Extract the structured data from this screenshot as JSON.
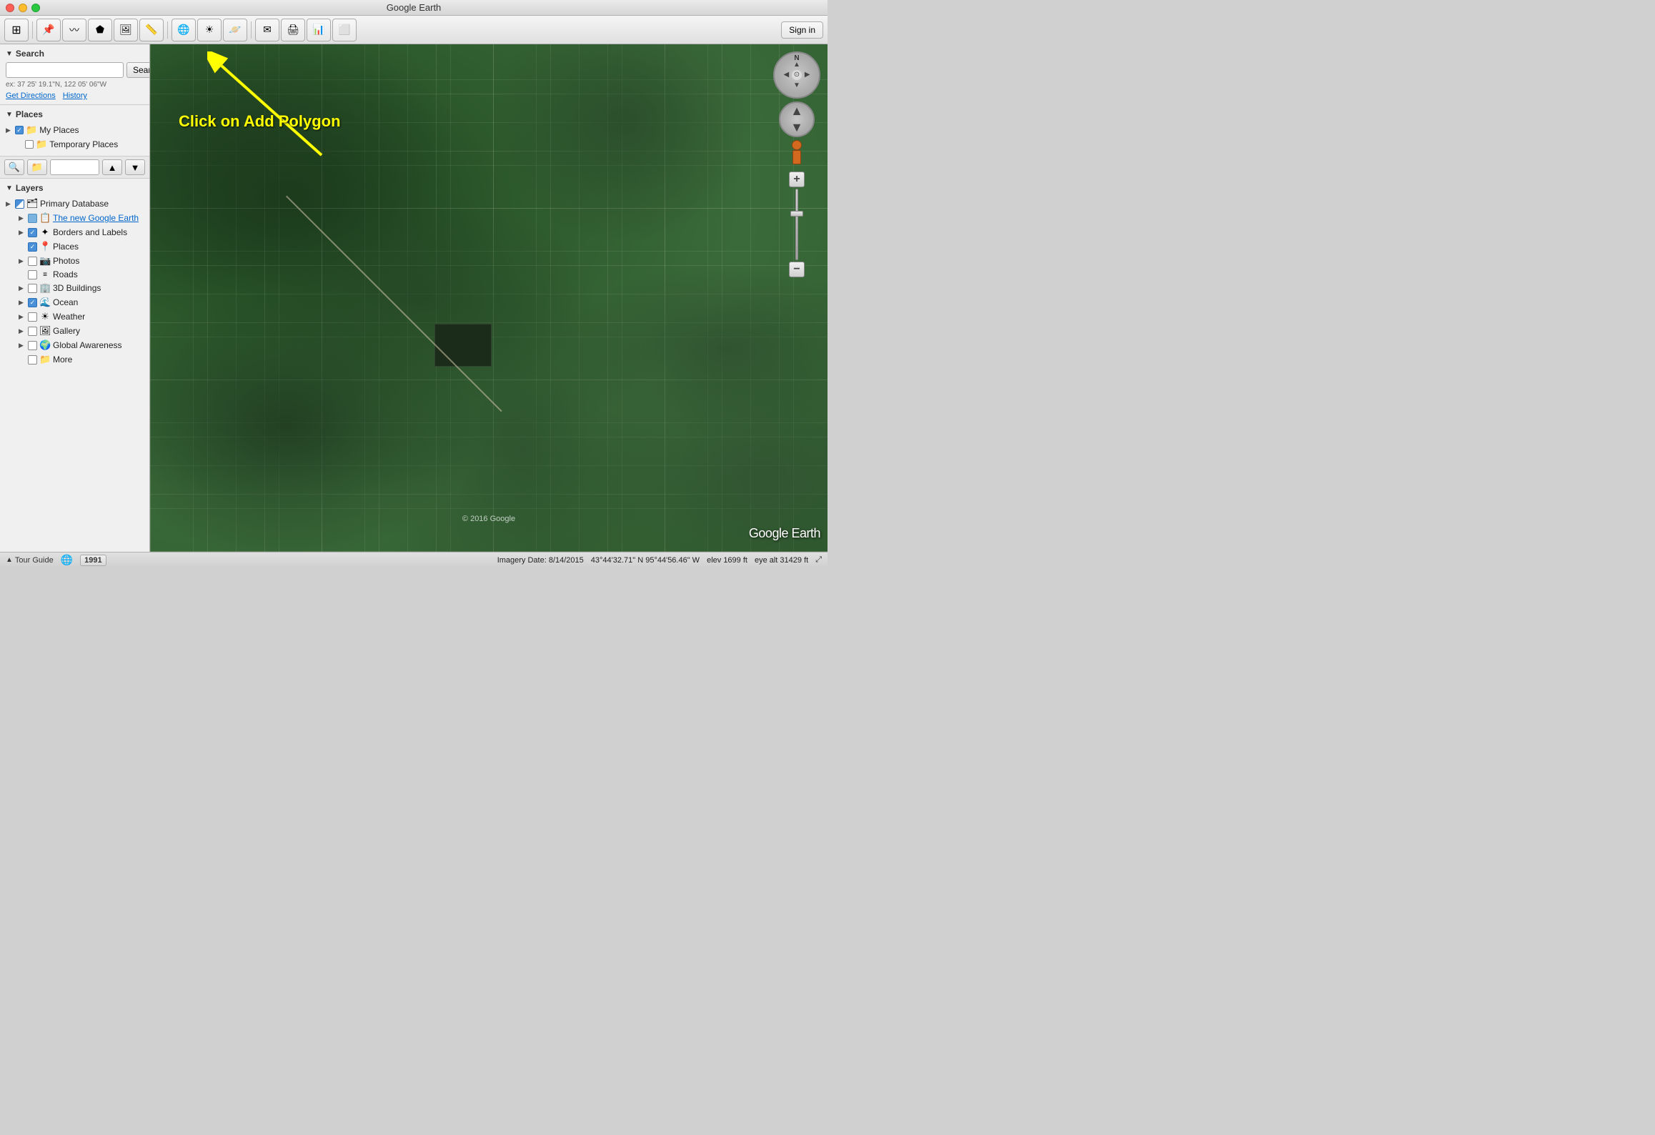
{
  "window": {
    "title": "Google Earth"
  },
  "toolbar": {
    "signin_label": "Sign in"
  },
  "search": {
    "header": "Search",
    "placeholder": "",
    "button_label": "Search",
    "hint": "ex: 37 25' 19.1\"N, 122 05' 06\"W",
    "get_directions_label": "Get Directions",
    "history_label": "History"
  },
  "places": {
    "header": "Places",
    "items": [
      {
        "label": "My Places",
        "checked": true,
        "has_arrow": true
      },
      {
        "label": "Temporary Places",
        "checked": false,
        "has_arrow": false
      }
    ]
  },
  "layers": {
    "header": "Layers",
    "items": [
      {
        "label": "Primary Database",
        "icon": "🗂",
        "has_arrow": true,
        "checked": "half",
        "indent": 0
      },
      {
        "label": "The new Google Earth",
        "icon": "📋",
        "has_arrow": true,
        "checked": false,
        "indent": 1,
        "is_link": true
      },
      {
        "label": "Borders and Labels",
        "icon": "✦",
        "has_arrow": true,
        "checked": true,
        "indent": 1
      },
      {
        "label": "Places",
        "icon": "📍",
        "has_arrow": false,
        "checked": true,
        "indent": 1
      },
      {
        "label": "Photos",
        "icon": "📷",
        "has_arrow": true,
        "checked": false,
        "indent": 1
      },
      {
        "label": "Roads",
        "icon": "≡",
        "has_arrow": false,
        "checked": false,
        "indent": 1
      },
      {
        "label": "3D Buildings",
        "icon": "🏢",
        "has_arrow": true,
        "checked": false,
        "indent": 1
      },
      {
        "label": "Ocean",
        "icon": "🌊",
        "has_arrow": true,
        "checked": true,
        "indent": 1
      },
      {
        "label": "Weather",
        "icon": "☀",
        "has_arrow": true,
        "checked": false,
        "indent": 1
      },
      {
        "label": "Gallery",
        "icon": "🖼",
        "has_arrow": true,
        "checked": false,
        "indent": 1
      },
      {
        "label": "Global Awareness",
        "icon": "🌍",
        "has_arrow": true,
        "checked": false,
        "indent": 1
      },
      {
        "label": "More",
        "icon": "📁",
        "has_arrow": false,
        "checked": false,
        "indent": 1
      }
    ]
  },
  "annotation": {
    "text": "Click on Add Polygon",
    "arrow_color": "#ffff00"
  },
  "map": {
    "copyright": "© 2016 Google",
    "watermark": "Google Earth"
  },
  "status_bar": {
    "tour_guide": "Tour Guide",
    "year": "1991",
    "imagery_date": "Imagery Date: 8/14/2015",
    "coordinates": "43°44'32.71\" N   95°44'56.46\" W",
    "elevation": "elev 1699 ft",
    "eye_alt": "eye alt  31429 ft"
  },
  "toolbar_buttons": [
    {
      "icon": "⊞",
      "title": "Show Sidebar",
      "name": "show-sidebar-btn"
    },
    {
      "icon": "★",
      "title": "Add Placemark",
      "name": "add-placemark-btn"
    },
    {
      "icon": "✚",
      "title": "Add Path",
      "name": "add-path-btn"
    },
    {
      "icon": "⬟",
      "title": "Add Polygon",
      "name": "add-polygon-btn"
    },
    {
      "icon": "⬖",
      "title": "Add Image Overlay",
      "name": "add-image-overlay-btn"
    },
    {
      "icon": "📐",
      "title": "Measure",
      "name": "measure-btn"
    },
    {
      "icon": "🌐",
      "title": "Tour",
      "name": "tour-btn"
    },
    {
      "icon": "☀",
      "title": "Sun",
      "name": "sun-btn"
    },
    {
      "icon": "⊙",
      "title": "Planets",
      "name": "planets-btn"
    },
    {
      "icon": "✉",
      "title": "Email",
      "name": "email-btn"
    },
    {
      "icon": "🖨",
      "title": "Print",
      "name": "print-btn"
    },
    {
      "icon": "📊",
      "title": "View in Maps",
      "name": "maps-btn"
    },
    {
      "icon": "⬜",
      "title": "Record Tour",
      "name": "record-btn"
    }
  ]
}
